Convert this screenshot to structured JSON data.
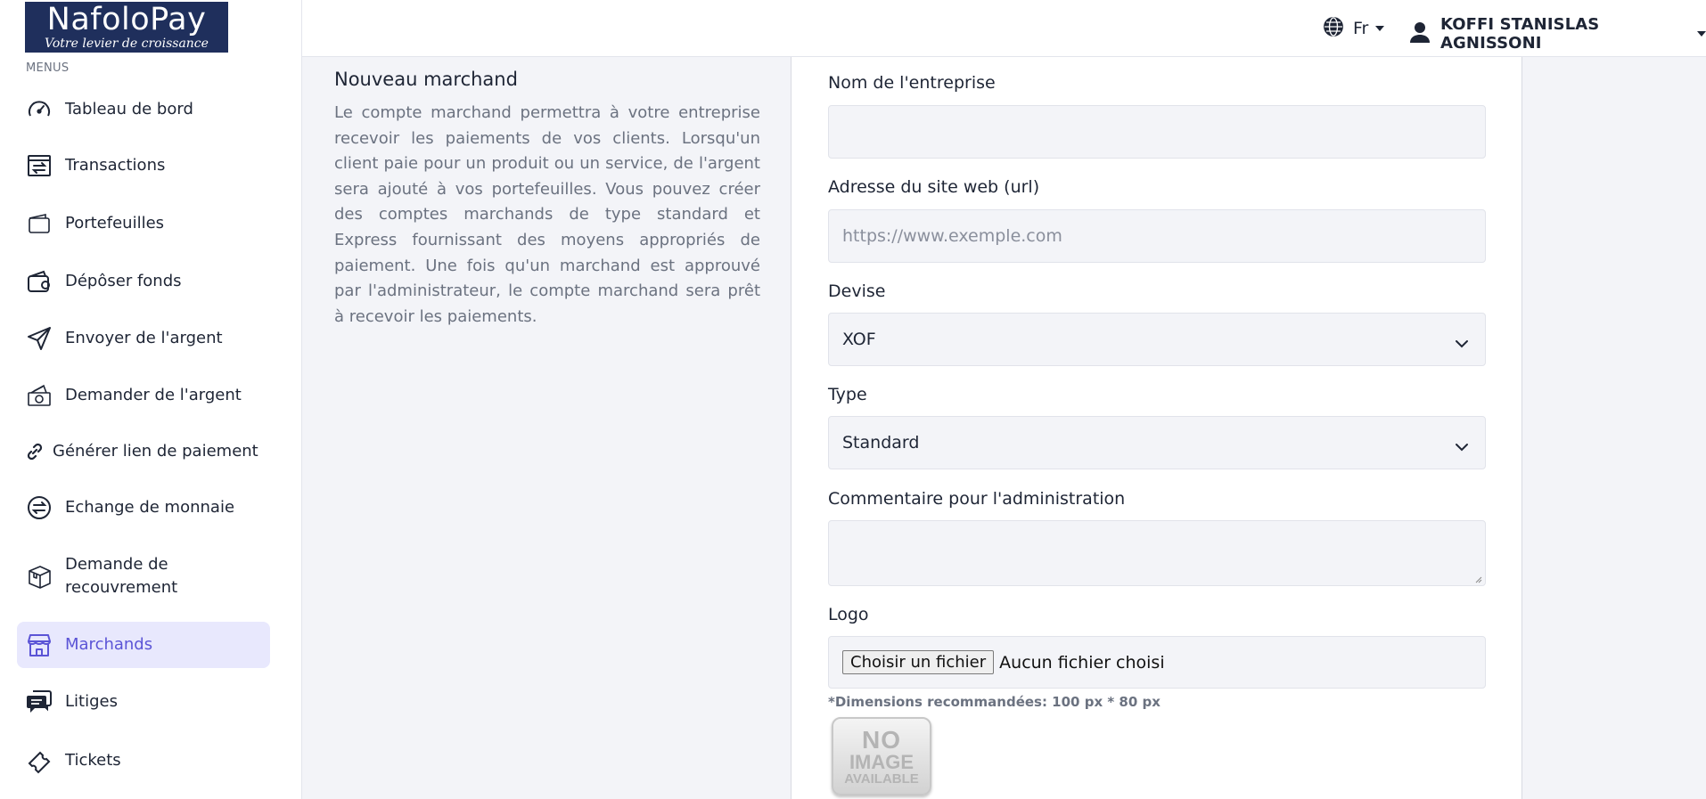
{
  "brand": {
    "name": "NafoloPay",
    "tagline": "Votre levier de croissance"
  },
  "sidebar": {
    "section_label": "MENUS",
    "items": [
      {
        "label": "Tableau de bord",
        "icon": "dashboard-gauge-icon"
      },
      {
        "label": "Transactions",
        "icon": "transactions-icon"
      },
      {
        "label": "Portefeuilles",
        "icon": "wallet-icon"
      },
      {
        "label": "Dépôser fonds",
        "icon": "deposit-wallet-icon"
      },
      {
        "label": "Envoyer de l'argent",
        "icon": "send-plane-icon"
      },
      {
        "label": "Demander de l'argent",
        "icon": "request-money-icon"
      },
      {
        "label": "Générer lien de paiement",
        "icon": "link-icon"
      },
      {
        "label": "Echange de monnaie",
        "icon": "exchange-icon"
      },
      {
        "label": "Demande de recouvrement",
        "icon": "package-icon"
      },
      {
        "label": "Marchands",
        "icon": "store-icon",
        "active": true
      },
      {
        "label": "Litiges",
        "icon": "chat-bubbles-icon"
      },
      {
        "label": "Tickets",
        "icon": "ticket-icon"
      }
    ]
  },
  "topbar": {
    "language": "Fr",
    "user_name": "KOFFI STANISLAS AGNISSONI"
  },
  "intro": {
    "title": "Nouveau marchand",
    "text": "Le compte marchand permettra à votre entreprise recevoir les paiements de vos clients. Lorsqu'un client paie pour un produit ou un service, de l'argent sera ajouté à vos portefeuilles. Vous pouvez créer des comptes marchands de type standard et Express fournissant des moyens appropriés de paiement. Une fois qu'un marchand est approuvé par l'administrateur, le compte marchand sera prêt à recevoir les paiements."
  },
  "form": {
    "company_label": "Nom de l'entreprise",
    "company_value": "",
    "website_label": "Adresse du site web (url)",
    "website_placeholder": "https://www.exemple.com",
    "currency_label": "Devise",
    "currency_value": "XOF",
    "type_label": "Type",
    "type_value": "Standard",
    "comment_label": "Commentaire pour l'administration",
    "comment_value": "",
    "logo_label": "Logo",
    "file_button": "Choisir un fichier",
    "file_status": "Aucun fichier choisi",
    "logo_hint": "*Dimensions recommandées: 100 px * 80 px",
    "placeholder_image": {
      "line1": "NO",
      "line2": "IMAGE",
      "line3": "AVAILABLE"
    }
  },
  "colors": {
    "brand_navy": "#1f2f5c",
    "accent": "#5b54d6",
    "active_bg": "#e8e8fd"
  }
}
